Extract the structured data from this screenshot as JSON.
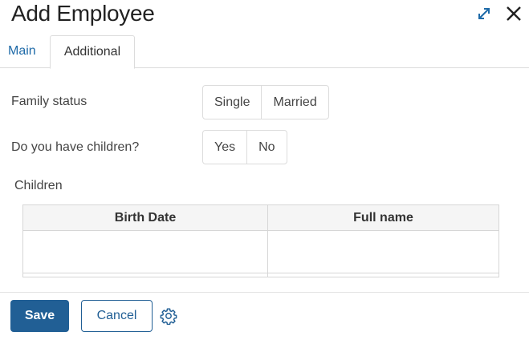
{
  "dialog": {
    "title": "Add Employee"
  },
  "tabs": [
    {
      "label": "Main",
      "active": false
    },
    {
      "label": "Additional",
      "active": true
    }
  ],
  "form": {
    "family_status": {
      "label": "Family status",
      "options": [
        "Single",
        "Married"
      ]
    },
    "has_children": {
      "label": "Do you have children?",
      "options": [
        "Yes",
        "No"
      ]
    },
    "children": {
      "label": "Children",
      "columns": [
        "Birth Date",
        "Full name"
      ],
      "rows": [
        [
          "",
          ""
        ]
      ]
    }
  },
  "footer": {
    "save_label": "Save",
    "cancel_label": "Cancel"
  },
  "colors": {
    "accent": "#215f95",
    "link": "#1e6aa8"
  }
}
